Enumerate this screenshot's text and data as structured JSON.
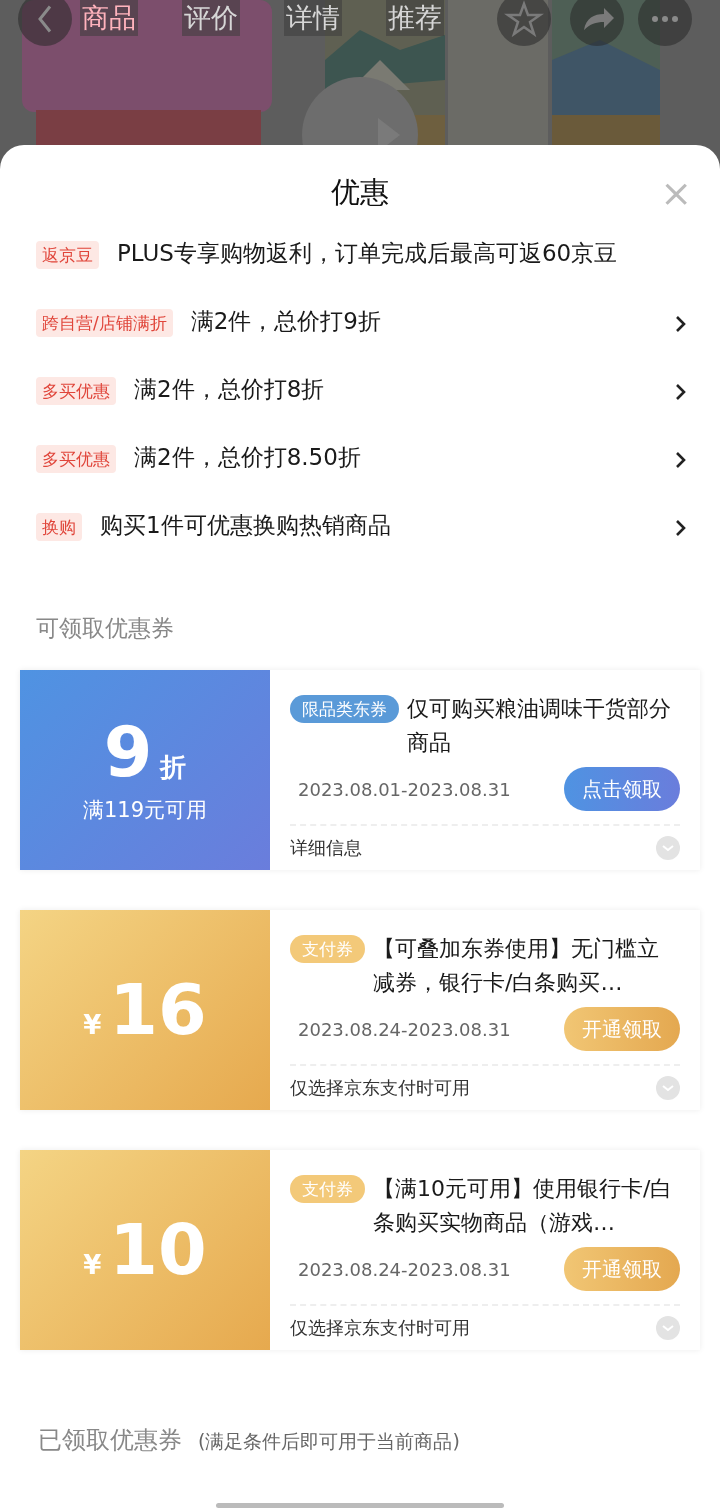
{
  "top_bar": {
    "tabs": [
      {
        "label": "商品",
        "selected": true
      },
      {
        "label": "评价",
        "selected": false
      },
      {
        "label": "详情",
        "selected": false
      },
      {
        "label": "推荐",
        "selected": false
      }
    ]
  },
  "sheet": {
    "title": "优惠",
    "close": "×"
  },
  "promotions": [
    {
      "tag": "返京豆",
      "text": "PLUS专享购物返利，订单完成后最高可返60京豆",
      "has_arrow": false
    },
    {
      "tag": "跨自营/店铺满折",
      "text": "满2件，总价打9折",
      "has_arrow": true
    },
    {
      "tag": "多买优惠",
      "text": "满2件，总价打8折",
      "has_arrow": true
    },
    {
      "tag": "多买优惠",
      "text": "满2件，总价打8.50折",
      "has_arrow": true
    },
    {
      "tag": "换购",
      "text": "购买1件可优惠换购热销商品",
      "has_arrow": true
    }
  ],
  "available_section": {
    "title": "可领取优惠券"
  },
  "coupons": [
    {
      "kind": "discount",
      "amount": "9",
      "unit": "折",
      "condition": "满119元可用",
      "tag": "限品类东券",
      "title": "仅可购买粮油调味干货部分商品",
      "date": "2023.08.01-2023.08.31",
      "button": "点击领取",
      "footer": "详细信息"
    },
    {
      "kind": "payment",
      "amount": "16",
      "unit": "¥",
      "tag": "支付券",
      "title": "【可叠加东券使用】无门槛立减券，银行卡/白条购买…",
      "date": "2023.08.24-2023.08.31",
      "button": "开通领取",
      "footer": "仅选择京东支付时可用"
    },
    {
      "kind": "payment",
      "amount": "10",
      "unit": "¥",
      "tag": "支付券",
      "title": "【满10元可用】使用银行卡/白条购买实物商品（游戏…",
      "date": "2023.08.24-2023.08.31",
      "button": "开通领取",
      "footer": "仅选择京东支付时可用"
    }
  ],
  "received_section": {
    "title": "已领取优惠券",
    "note": "(满足条件后即可用于当前商品)"
  }
}
